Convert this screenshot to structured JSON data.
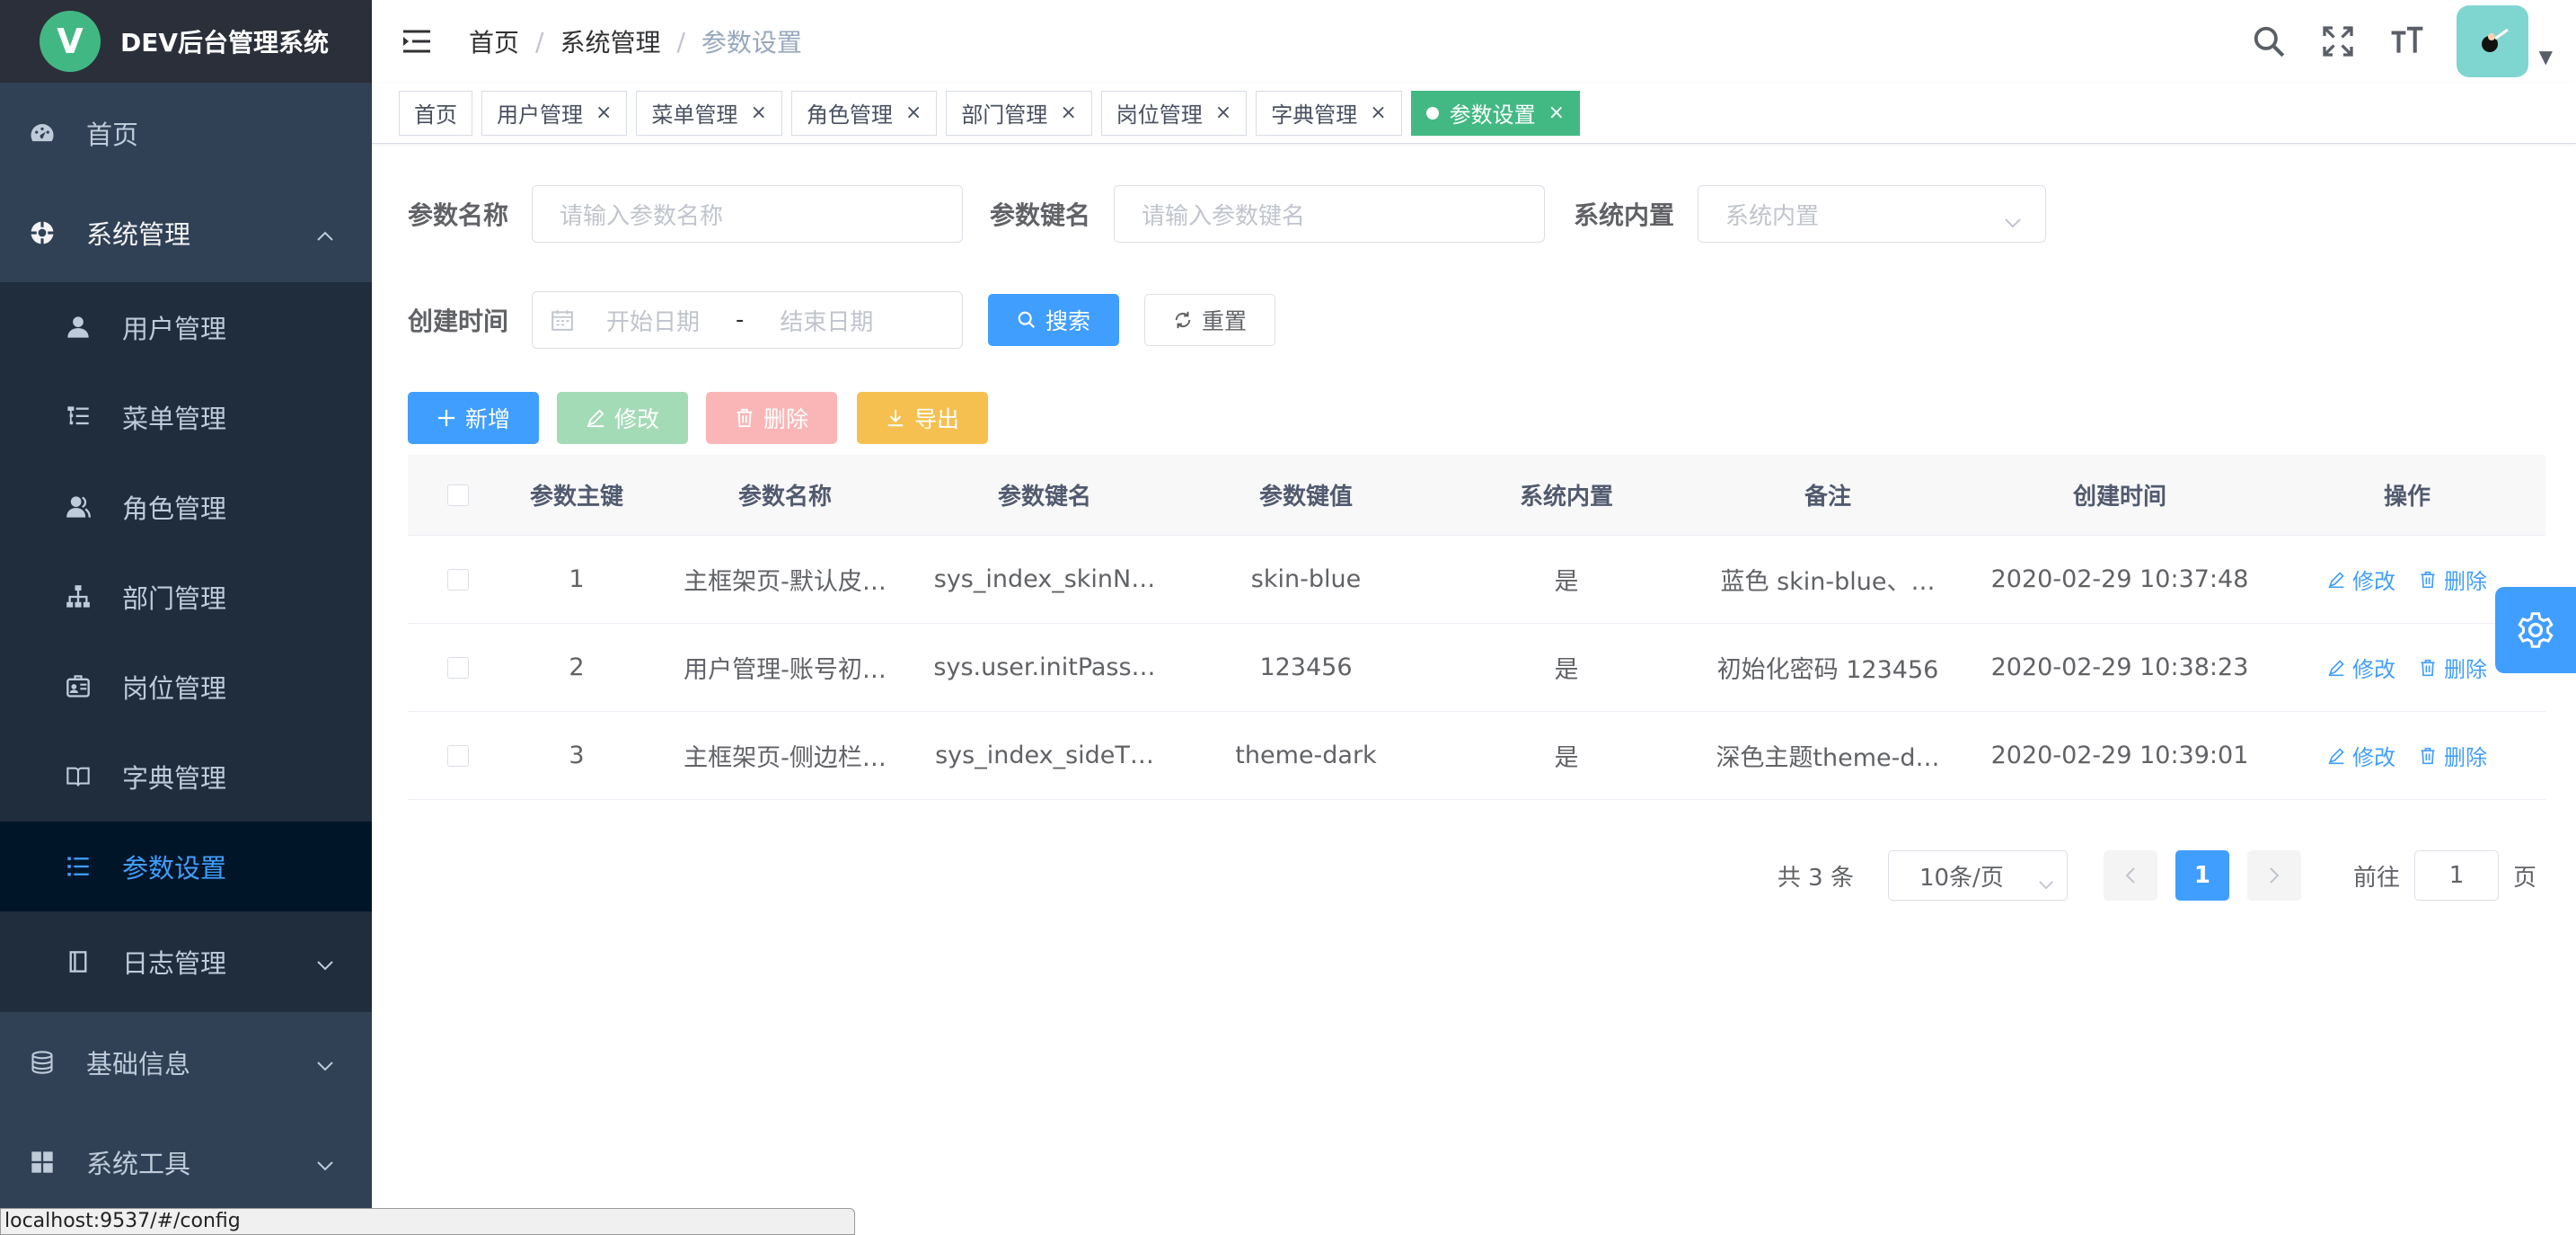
{
  "app": {
    "logo_letter": "V",
    "title": "DEV后台管理系统"
  },
  "sidebar": {
    "home": "首页",
    "system": "系统管理",
    "sub_items": [
      {
        "label": "用户管理",
        "icon": "user-icon"
      },
      {
        "label": "菜单管理",
        "icon": "tree-table-icon"
      },
      {
        "label": "角色管理",
        "icon": "peoples-icon"
      },
      {
        "label": "部门管理",
        "icon": "tree-icon"
      },
      {
        "label": "岗位管理",
        "icon": "post-icon"
      },
      {
        "label": "字典管理",
        "icon": "dict-icon"
      },
      {
        "label": "参数设置",
        "icon": "list-icon",
        "active": true
      },
      {
        "label": "日志管理",
        "icon": "log-icon"
      }
    ],
    "basic_info": "基础信息",
    "tools": "系统工具"
  },
  "breadcrumb": [
    "首页",
    "系统管理",
    "参数设置"
  ],
  "tags": [
    "首页",
    "用户管理",
    "菜单管理",
    "角色管理",
    "部门管理",
    "岗位管理",
    "字典管理",
    "参数设置"
  ],
  "search": {
    "name_label": "参数名称",
    "name_placeholder": "请输入参数名称",
    "key_label": "参数键名",
    "key_placeholder": "请输入参数键名",
    "type_label": "系统内置",
    "type_placeholder": "系统内置",
    "time_label": "创建时间",
    "start_placeholder": "开始日期",
    "range_sep": "-",
    "end_placeholder": "结束日期",
    "search_btn": "搜索",
    "reset_btn": "重置"
  },
  "toolbar": {
    "add": "新增",
    "edit": "修改",
    "delete": "删除",
    "export": "导出"
  },
  "table": {
    "headers": [
      "参数主键",
      "参数名称",
      "参数键名",
      "参数键值",
      "系统内置",
      "备注",
      "创建时间",
      "操作"
    ],
    "rows": [
      {
        "id": "1",
        "name": "主框架页-默认皮…",
        "key": "sys_index_skinN…",
        "value": "skin-blue",
        "builtin": "是",
        "remark": "蓝色 skin-blue、…",
        "time": "2020-02-29 10:37:48"
      },
      {
        "id": "2",
        "name": "用户管理-账号初…",
        "key": "sys.user.initPass…",
        "value": "123456",
        "builtin": "是",
        "remark": "初始化密码 123456",
        "time": "2020-02-29 10:38:23"
      },
      {
        "id": "3",
        "name": "主框架页-侧边栏…",
        "key": "sys_index_sideT…",
        "value": "theme-dark",
        "builtin": "是",
        "remark": "深色主题theme-d…",
        "time": "2020-02-29 10:39:01"
      }
    ],
    "op_edit": "修改",
    "op_delete": "删除"
  },
  "pagination": {
    "total": "共 3 条",
    "page_size": "10条/页",
    "current": "1",
    "goto_label": "前往",
    "goto_value": "1",
    "page_suffix": "页"
  },
  "status_url": "localhost:9537/#/config",
  "colors": {
    "primary": "#409eff",
    "success": "#42b983",
    "sidebar_bg": "#304156",
    "danger_light": "#fab6b6",
    "success_light": "#a3dbb7",
    "warning": "#f6c050"
  }
}
